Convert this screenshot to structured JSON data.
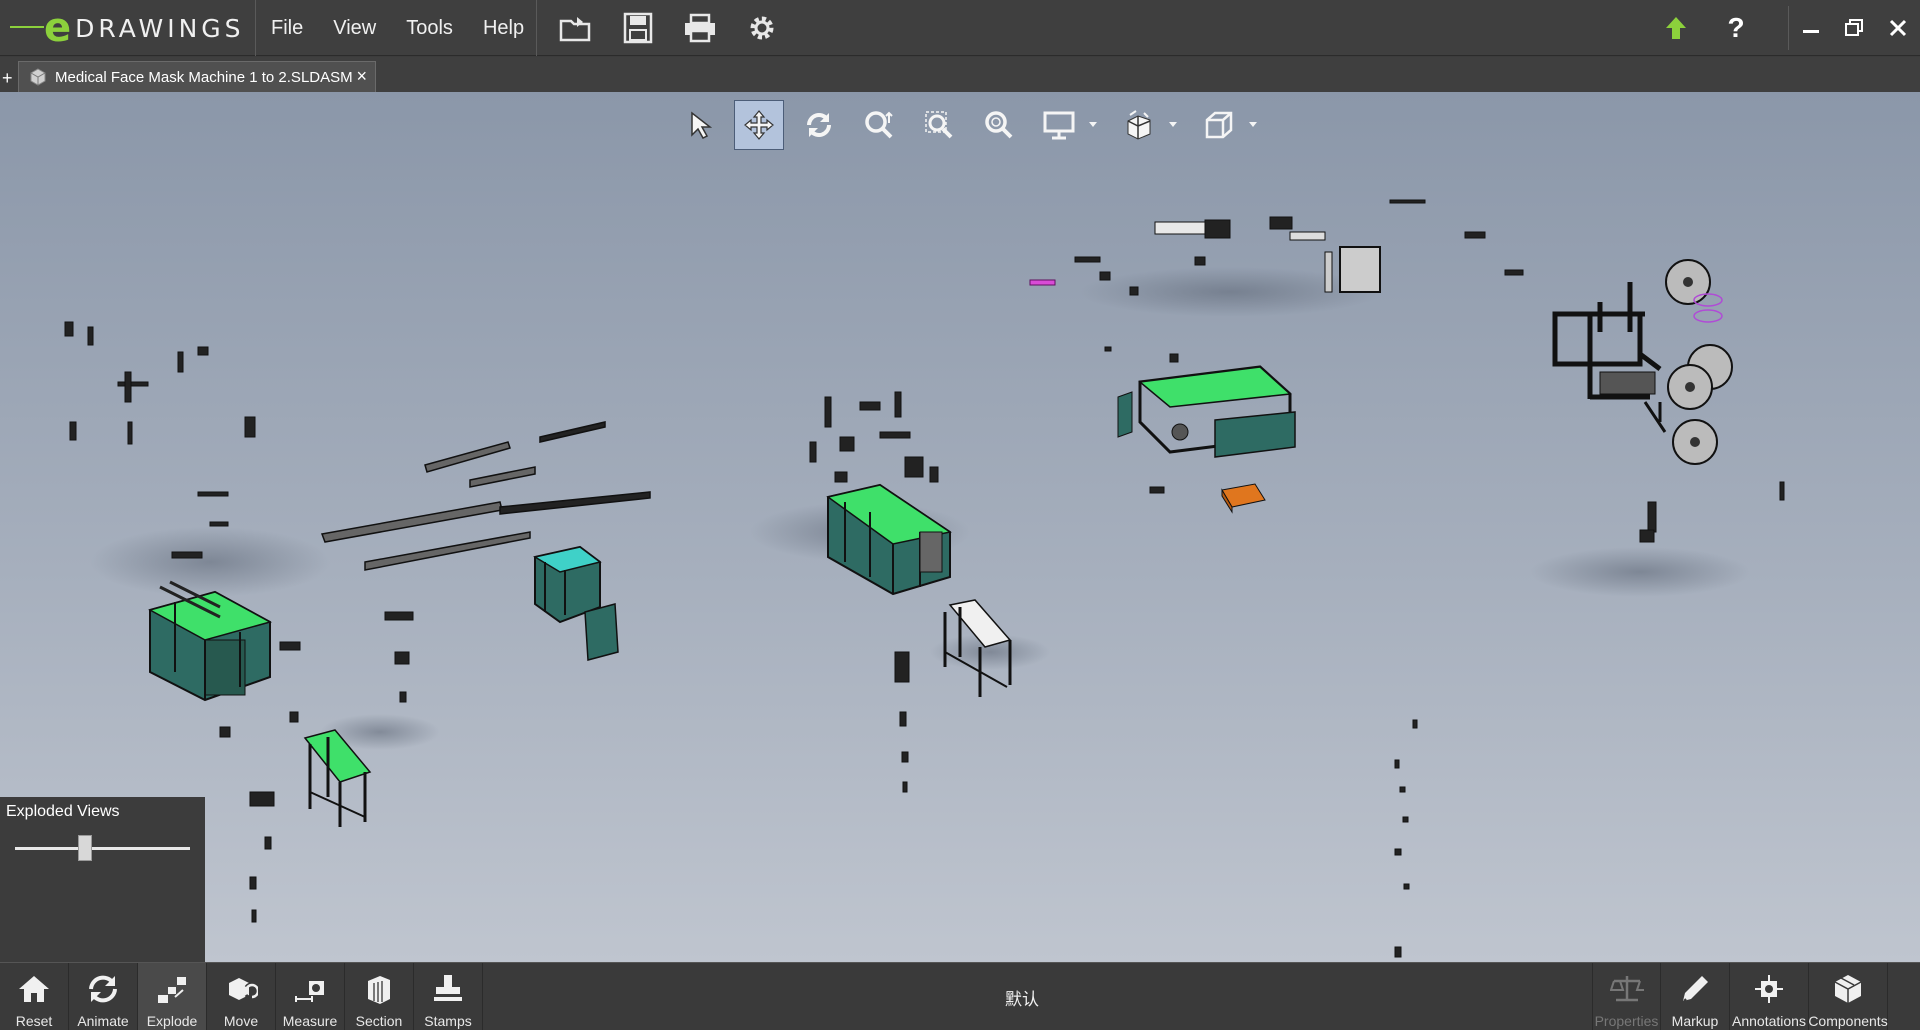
{
  "app": {
    "logo_letter": "e",
    "logo_text": "DRAWINGS"
  },
  "menu": [
    {
      "label": "File"
    },
    {
      "label": "View"
    },
    {
      "label": "Tools"
    },
    {
      "label": "Help"
    }
  ],
  "quick_tools": [
    "open-icon",
    "save-icon",
    "print-icon",
    "settings-icon"
  ],
  "window_controls": [
    "update-arrow-icon",
    "help-icon",
    "minimize-icon",
    "restore-icon",
    "close-icon"
  ],
  "help_label": "?",
  "tab": {
    "label": "Medical Face Mask Machine 1 to 2.SLDASM",
    "new_tab": "+",
    "close": "×"
  },
  "view_toolbar": [
    "select-icon",
    "pan-icon",
    "rotate-icon",
    "zoom-icon",
    "zoom-area-icon",
    "zoom-fit-icon",
    "display-style-icon",
    "view-orientation-icon",
    "standard-views-icon"
  ],
  "exploded_panel": {
    "title": "Exploded Views",
    "slider_value": 0.4
  },
  "configuration": "默认",
  "bottom_left": [
    {
      "label": "Reset",
      "icon": "home-icon"
    },
    {
      "label": "Animate",
      "icon": "animate-icon"
    },
    {
      "label": "Explode",
      "icon": "explode-icon",
      "active": true
    },
    {
      "label": "Move",
      "icon": "move-icon"
    },
    {
      "label": "Measure",
      "icon": "measure-icon"
    },
    {
      "label": "Section",
      "icon": "section-icon"
    },
    {
      "label": "Stamps",
      "icon": "stamps-icon"
    }
  ],
  "bottom_right": [
    {
      "label": "Properties",
      "icon": "properties-icon",
      "disabled": true
    },
    {
      "label": "Markup",
      "icon": "markup-icon"
    },
    {
      "label": "Annotations",
      "icon": "annotations-icon"
    },
    {
      "label": "Components",
      "icon": "components-icon"
    }
  ],
  "colors": {
    "accent_green": "#3fe06a",
    "machine_body": "#2e6b63",
    "logo_green": "#8cd13c",
    "orange_part": "#e0761e",
    "magenta_part": "#d94bd6"
  }
}
